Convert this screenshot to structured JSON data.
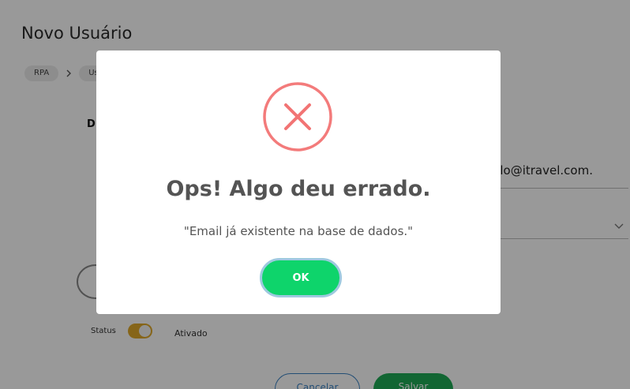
{
  "page": {
    "title": "Novo Usuário",
    "breadcrumb": [
      "RPA",
      "Us"
    ],
    "section_heading": "D",
    "email_value": "emplo@itravel.com.",
    "status_label": "Status",
    "status_value": "Ativado",
    "cancel_label": "Cancelar",
    "save_label": "Salvar"
  },
  "modal": {
    "icon": "error-x-circle-icon",
    "title": "Ops! Algo deu errado.",
    "message": "\"Email já existente na base de dados.\"",
    "ok_label": "OK"
  },
  "colors": {
    "error": "#f27474",
    "ok_button": "#0ed46b",
    "toggle_on": "#e0a92a",
    "save_button": "#1faa55",
    "cancel_border": "#3b82c4"
  }
}
